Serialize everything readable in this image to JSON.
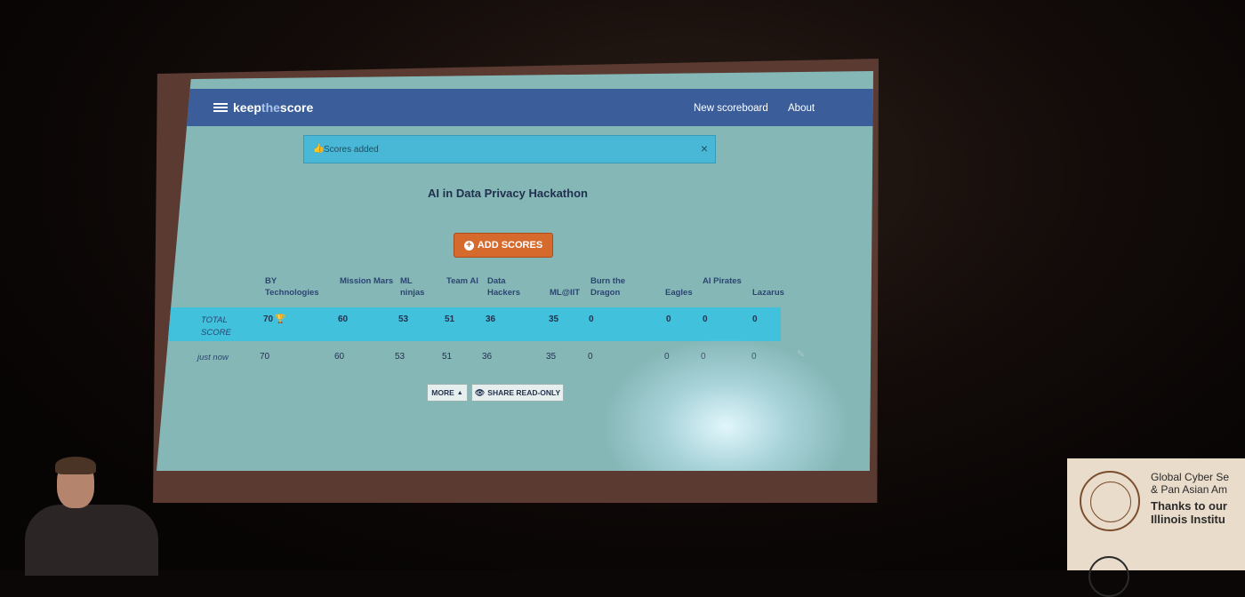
{
  "app": {
    "brand_prefix": "keep",
    "brand_accent": "the",
    "brand_suffix": "score",
    "nav": [
      "New scoreboard",
      "About"
    ]
  },
  "alert": {
    "text": "Scores added",
    "close": "×"
  },
  "scoreboard": {
    "title": "AI in Data Privacy Hackathon",
    "add_button": "ADD SCORES",
    "teams": [
      "BY Technologies",
      "Mission Mars",
      "ML ninjas",
      "Team AI",
      "Data Hackers",
      "ML@IIT",
      "Burn the Dragon",
      "Eagles",
      "AI Pirates",
      "Lazarus"
    ],
    "total_label": "TOTAL SCORE",
    "totals": [
      "70",
      "60",
      "53",
      "51",
      "36",
      "35",
      "0",
      "0",
      "0",
      "0"
    ],
    "entry_label": "just now",
    "entry": [
      "70",
      "60",
      "53",
      "51",
      "36",
      "35",
      "0",
      "0",
      "0",
      "0"
    ],
    "more_button": "MORE",
    "share_button": "SHARE READ-ONLY"
  },
  "banner": {
    "line1": "Global Cyber Se",
    "line2": "& Pan Asian Am",
    "line3": "Thanks to our",
    "line4": "Illinois Institu"
  },
  "colors": {
    "navbar": "#3b5e9a",
    "page": "#86b7b7",
    "alert": "#49b8d6",
    "add_button": "#d66a2c",
    "total_row": "#42c1dd"
  },
  "icons": [
    "menu-lines-icon",
    "thumbs-up-icon",
    "close-icon",
    "plus-circle-icon",
    "trophy-icon",
    "pencil-icon",
    "caret-up-icon",
    "eye-icon"
  ]
}
